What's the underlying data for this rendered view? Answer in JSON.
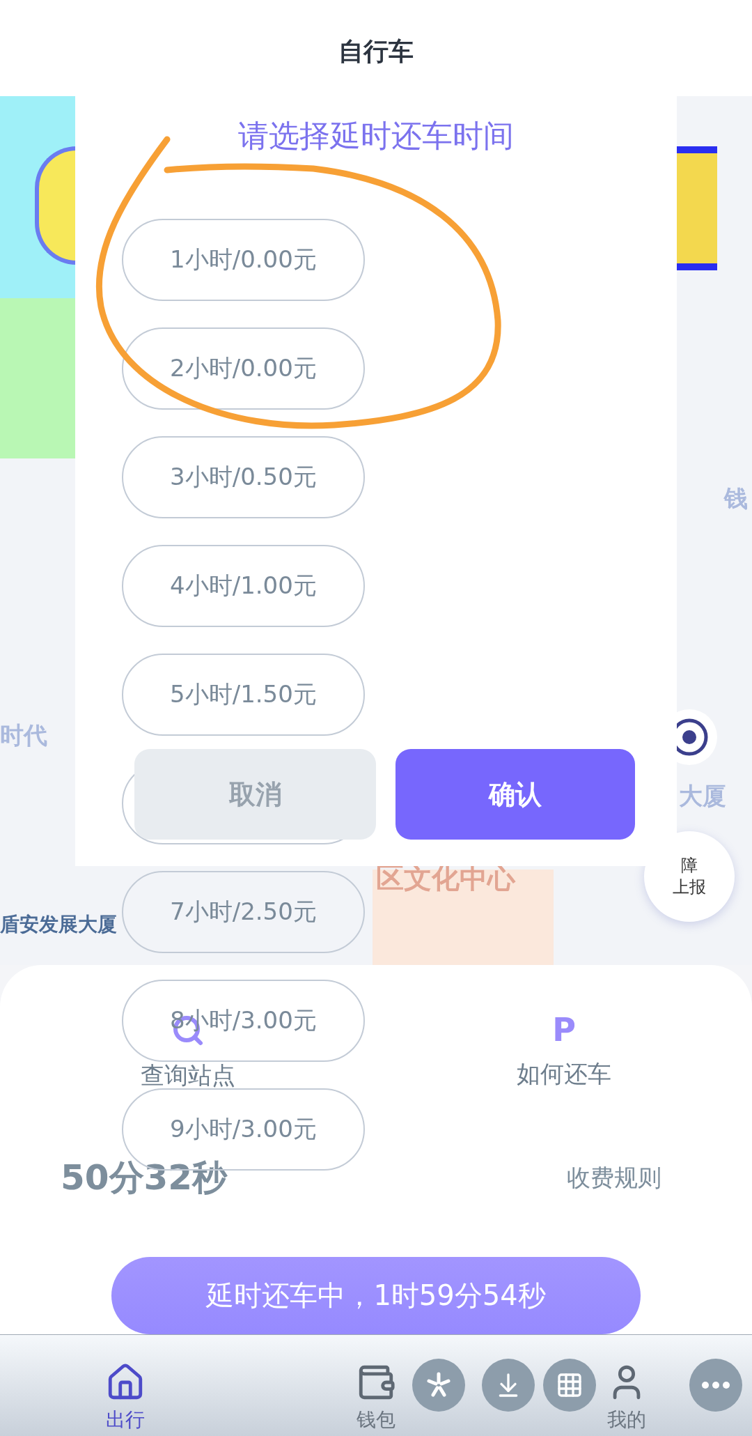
{
  "header": {
    "title": "自行车"
  },
  "map": {
    "labels": [
      {
        "text": "钱",
        "kind": "road"
      },
      {
        "text": "时代",
        "kind": "road"
      },
      {
        "text": "大厦",
        "kind": "road"
      },
      {
        "text": "区文化中心",
        "kind": "landmark"
      },
      {
        "text": "盾安发展大厦",
        "kind": "poi"
      }
    ],
    "report_button": {
      "lines": [
        "障",
        "上报"
      ]
    }
  },
  "dialog": {
    "title": "请选择延时还车时间",
    "options": [
      {
        "kind": "text",
        "label": "1小时/0.00元"
      },
      {
        "kind": "text",
        "label": "2小时/0.00元"
      },
      {
        "kind": "text",
        "label": "3小时/0.50元"
      },
      {
        "kind": "text",
        "label": "4小时/1.00元"
      },
      {
        "kind": "text",
        "label": "5小时/1.50元"
      },
      {
        "kind": "covered"
      },
      {
        "kind": "text",
        "label": "7小时/2.50元"
      },
      {
        "kind": "text",
        "label": "8小时/3.00元"
      },
      {
        "kind": "text",
        "label": "9小时/3.00元"
      }
    ],
    "cancel": "取消",
    "confirm": "确认"
  },
  "panel": {
    "actions": [
      {
        "label": "查询站点",
        "kind": "icon"
      },
      {
        "label": "如何还车",
        "kind": "glyph",
        "glyph": "P"
      }
    ],
    "timer": "50分32秒",
    "rules_link": "收费规则",
    "status_button": "延时还车中，1时59分54秒"
  },
  "nav": [
    {
      "label": "出行",
      "selected": true
    },
    {
      "label": "钱包",
      "selected": false
    },
    {
      "label": "我的",
      "selected": false
    }
  ]
}
